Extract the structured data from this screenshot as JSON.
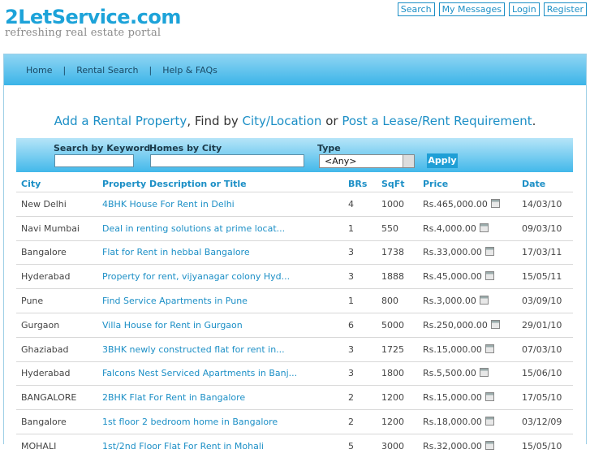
{
  "logo": {
    "name": "2LetService.com",
    "tagline": "refreshing real estate portal"
  },
  "toplinks": [
    "Search",
    "My Messages",
    "Login",
    "Register"
  ],
  "nav": [
    "Home",
    "Rental Search",
    "Help & FAQs"
  ],
  "headline": {
    "link1": "Add a Rental Property",
    "text1": ", Find by ",
    "link2": "City/Location",
    "text2": " or ",
    "link3": "Post a Lease/Rent Requirement",
    "text3": "."
  },
  "search": {
    "keyword_label": "Search by Keyword",
    "city_label": "Homes by City",
    "type_label": "Type",
    "type_value": "<Any>",
    "apply_label": "Apply"
  },
  "table": {
    "headers": [
      "City",
      "Property Description or Title",
      "BRs",
      "SqFt",
      "Price",
      "Date"
    ],
    "rows": [
      [
        "New Delhi",
        "4BHK House For Rent in Delhi",
        "4",
        "1000",
        "Rs.465,000.00",
        "14/03/10"
      ],
      [
        "Navi Mumbai",
        "Deal in renting solutions at prime locat...",
        "1",
        "550",
        "Rs.4,000.00",
        "09/03/10"
      ],
      [
        "Bangalore",
        "Flat for Rent in hebbal Bangalore",
        "3",
        "1738",
        "Rs.33,000.00",
        "17/03/11"
      ],
      [
        "Hyderabad",
        "Property for rent, vijyanagar colony Hyd...",
        "3",
        "1888",
        "Rs.45,000.00",
        "15/05/11"
      ],
      [
        "Pune",
        "Find Service Apartments in Pune",
        "1",
        "800",
        "Rs.3,000.00",
        "03/09/10"
      ],
      [
        "Gurgaon",
        "Villa House for Rent in Gurgaon",
        "6",
        "5000",
        "Rs.250,000.00",
        "29/01/10"
      ],
      [
        "Ghaziabad",
        "3BHK newly constructed flat for rent in...",
        "3",
        "1725",
        "Rs.15,000.00",
        "07/03/10"
      ],
      [
        "Hyderabad",
        "Falcons Nest Serviced Apartments in Banj...",
        "3",
        "1800",
        "Rs.5,500.00",
        "15/06/10"
      ],
      [
        "BANGALORE",
        "2BHK Flat For Rent in Bangalore",
        "2",
        "1200",
        "Rs.15,000.00",
        "17/05/10"
      ],
      [
        "Bangalore",
        "1st floor 2 bedroom home in Bangalore",
        "2",
        "1200",
        "Rs.18,000.00",
        "03/12/09"
      ],
      [
        "MOHALI",
        "1st/2nd Floor Flat For Rent in Mohali",
        "5",
        "3000",
        "Rs.32,000.00",
        "15/05/10"
      ]
    ]
  },
  "colors": {
    "accent": "#1c8fc6",
    "nav_bg": "#3bb4e8",
    "logo": "#1da3d9"
  }
}
